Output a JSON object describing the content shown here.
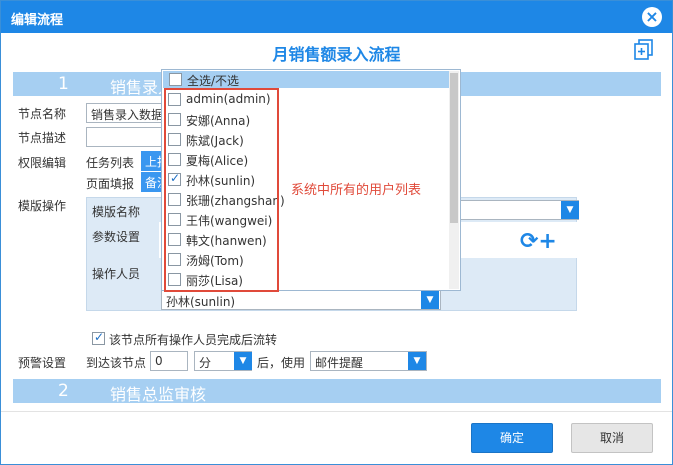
{
  "dialog": {
    "title": "编辑流程",
    "close_glyph": "×"
  },
  "main_title": "月销售额录入流程",
  "sections": [
    {
      "num": "1",
      "name": "销售录入"
    },
    {
      "num": "2",
      "name": "销售总监审核"
    }
  ],
  "form": {
    "node_name_label": "节点名称",
    "node_name_value": "销售录入数据",
    "node_desc_label": "节点描述",
    "node_desc_value": "",
    "permission_label": "权限编辑",
    "task_list_label": "任务列表",
    "task_list_chip": "上报",
    "page_fill_label": "页面填报",
    "page_fill_chip": "备注",
    "template_op_label": "模版操作",
    "template_name_label": "模版名称",
    "param_setting_label": "参数设置",
    "operator_label": "操作人员",
    "operator_value": "孙林(sunlin)",
    "flow_after_all": "该节点所有操作人员完成后流转",
    "warning_label": "预警设置",
    "arrive_label": "到达该节点",
    "arrive_value": "0",
    "unit_value": "分",
    "use_label": "后，使用",
    "notify_value": "邮件提醒"
  },
  "popup": {
    "select_all": "全选/不选",
    "users": [
      {
        "name": "admin(admin)",
        "checked": false
      },
      {
        "name": "安娜(Anna)",
        "checked": false
      },
      {
        "name": "陈斌(Jack)",
        "checked": false
      },
      {
        "name": "夏梅(Alice)",
        "checked": false
      },
      {
        "name": "孙林(sunlin)",
        "checked": true
      },
      {
        "name": "张珊(zhangshan)",
        "checked": false
      },
      {
        "name": "王伟(wangwei)",
        "checked": false
      },
      {
        "name": "韩文(hanwen)",
        "checked": false
      },
      {
        "name": "汤姆(Tom)",
        "checked": false
      },
      {
        "name": "丽莎(Lisa)",
        "checked": false
      }
    ]
  },
  "annotation": "系统中所有的用户列表",
  "refresh_plus": "⟳+",
  "buttons": {
    "ok": "确定",
    "cancel": "取消"
  },
  "icons": {
    "close": "close-icon",
    "copy": "copy-add-icon",
    "dropdown": "chevron-down-icon",
    "refresh": "refresh-icon",
    "add": "plus-icon"
  },
  "colors": {
    "primary": "#1e87e6",
    "section": "#a6cff2",
    "annotation": "#e04a3a"
  }
}
